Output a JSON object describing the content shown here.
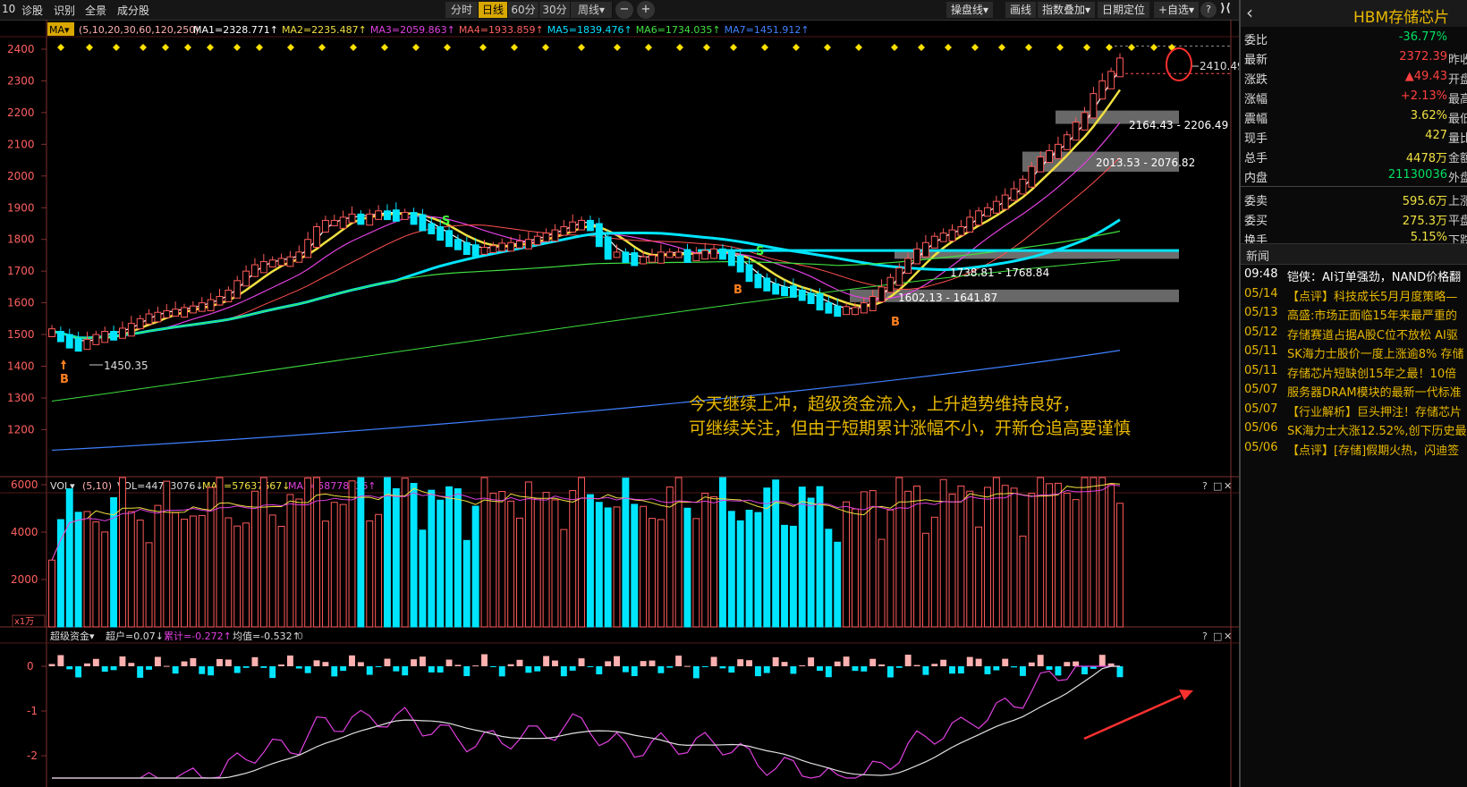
{
  "toolbar": {
    "left_items": [
      "10",
      "诊股",
      "识别",
      "全景",
      "成分股"
    ],
    "periods": [
      "分时",
      "日线",
      "60分",
      "30分",
      "周线▾"
    ],
    "active_period": "日线",
    "zoom_minus": "−",
    "zoom_plus": "+",
    "tools": [
      "操盘线▾",
      "画线",
      "指数叠加▾",
      "日期定位",
      "+自选▾"
    ],
    "help": "?",
    "collapse": "⟩⟨"
  },
  "main_chart": {
    "indicator_name": "MA▾",
    "params": "(5,10,20,30,60,120,250)",
    "ma_values": [
      {
        "label": "MA1=2328.771↑",
        "color": "#ffffff"
      },
      {
        "label": "MA2=2235.487↑",
        "color": "#f0e040"
      },
      {
        "label": "MA3=2059.863↑",
        "color": "#e040e0"
      },
      {
        "label": "MA4=1933.859↑",
        "color": "#ff6060"
      },
      {
        "label": "MA5=1839.476↑",
        "color": "#00e0ff"
      },
      {
        "label": "MA6=1734.035↑",
        "color": "#40e040"
      },
      {
        "label": "MA7=1451.912↑",
        "color": "#4080ff"
      }
    ],
    "y_ticks": [
      "2400",
      "2300",
      "2200",
      "2100",
      "2000",
      "1900",
      "1800",
      "1700",
      "1600",
      "1500",
      "1400",
      "1300",
      "1200"
    ],
    "price_annotations": [
      "2410.49",
      "2164.43 - 2206.49",
      "2013.53 - 2076.82",
      "1738.81 - 1768.84",
      "1602.13 - 1641.87",
      "1450.35"
    ],
    "signals": [
      "S",
      "S",
      "B",
      "B",
      "B"
    ],
    "comment_line1": "今天继续上冲，超级资金流入，上升趋势维持良好，",
    "comment_line2": "可继续关注，但由于短期累计涨幅不小，开新仓追高要谨慎"
  },
  "vol_chart": {
    "indicator_name": "VOL▾",
    "params": "(5,10)",
    "vol": "VOL=44783076↓",
    "ma1": "MA1=57637667↓",
    "ma2": "MA2=58778836↑",
    "y_ticks": [
      "6000",
      "4000",
      "2000"
    ],
    "unit": "x1万"
  },
  "fund_chart": {
    "indicator_name": "超级资金▾",
    "chao": "超户=0.07↓",
    "leiji": "累计=-0.272↑",
    "junzhi": "均值=-0.532↑",
    "zero": "0",
    "y_ticks": [
      "0",
      "-1",
      "-2"
    ]
  },
  "panel_controls": [
    "?",
    "□",
    "✕"
  ],
  "sidebar": {
    "back": "‹",
    "title": "HBM存储芯片",
    "stats": [
      {
        "label": "委比",
        "value": "-36.77%",
        "color": "#00e060",
        "extra": ""
      },
      {
        "label": "最新",
        "value": "2372.39",
        "color": "#ff4040",
        "extra": "昨收"
      },
      {
        "label": "涨跌",
        "value": "▲49.43",
        "color": "#ff4040",
        "extra": "开盘"
      },
      {
        "label": "涨幅",
        "value": "+2.13%",
        "color": "#ff4040",
        "extra": "最高"
      },
      {
        "label": "震幅",
        "value": "3.62%",
        "color": "#f0e040",
        "extra": "最低"
      },
      {
        "label": "现手",
        "value": "427",
        "color": "#f0e040",
        "extra": "量比"
      },
      {
        "label": "总手",
        "value": "4478万",
        "color": "#f0e040",
        "extra": "金额"
      },
      {
        "label": "内盘",
        "value": "21130036",
        "color": "#00e060",
        "extra": "外盘"
      },
      {
        "label": "委卖",
        "value": "595.6万",
        "color": "#f0e040",
        "extra": "上涨"
      },
      {
        "label": "委买",
        "value": "275.3万",
        "color": "#f0e040",
        "extra": "平盘"
      },
      {
        "label": "换手",
        "value": "5.15%",
        "color": "#f0e040",
        "extra": "下跌"
      }
    ],
    "news_header": "新闻",
    "news": [
      {
        "date": "09:48",
        "title": "铠侠：AI订单强劲，NAND价格翻",
        "color": "#ffffff"
      },
      {
        "date": "05/14",
        "title": "【点评】科技成长5月月度策略—",
        "color": "#e8b800"
      },
      {
        "date": "05/13",
        "title": "高盛:市场正面临15年来最严重的",
        "color": "#e8b800"
      },
      {
        "date": "05/12",
        "title": "存储赛道占据A股C位不放松 AI驱",
        "color": "#e8b800"
      },
      {
        "date": "05/11",
        "title": "SK海力士股价一度上涨逾8% 存储",
        "color": "#e8b800"
      },
      {
        "date": "05/11",
        "title": "存储芯片短缺创15年之最！10倍",
        "color": "#e8b800"
      },
      {
        "date": "05/07",
        "title": "服务器DRAM模块的最新一代标准",
        "color": "#e8b800"
      },
      {
        "date": "05/07",
        "title": "【行业解析】巨头押注！存储芯片",
        "color": "#e8b800"
      },
      {
        "date": "05/06",
        "title": "SK海力士大涨12.52%,创下历史最",
        "color": "#e8b800"
      },
      {
        "date": "05/06",
        "title": "【点评】[存储]假期火热，闪迪签",
        "color": "#e8b800"
      }
    ]
  },
  "colors": {
    "up": "#ff5a5a",
    "down": "#00e5ff",
    "ma5": "#ffffff",
    "ma10": "#f0e040"
  }
}
